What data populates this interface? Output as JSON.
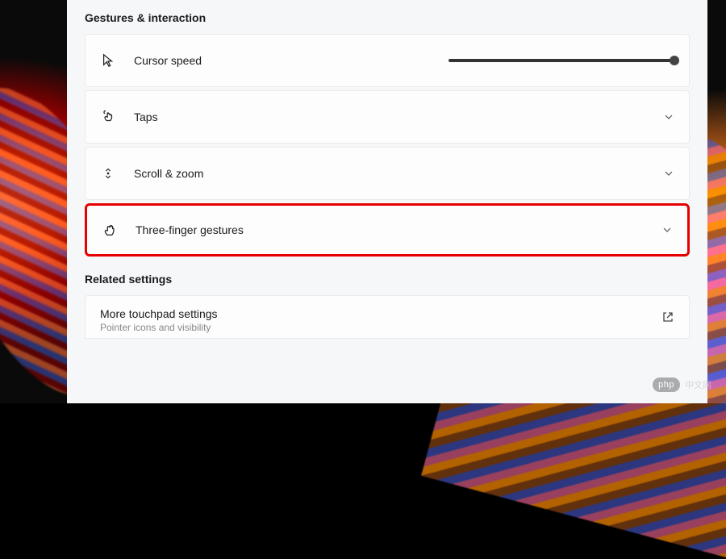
{
  "sections": {
    "gestures": {
      "header": "Gestures & interaction",
      "items": {
        "cursor_speed": {
          "label": "Cursor speed"
        },
        "taps": {
          "label": "Taps"
        },
        "scroll_zoom": {
          "label": "Scroll & zoom"
        },
        "three_finger": {
          "label": "Three-finger gestures"
        }
      }
    },
    "related": {
      "header": "Related settings",
      "more_touchpad": {
        "title": "More touchpad settings",
        "subtitle": "Pointer icons and visibility"
      }
    }
  },
  "watermark": {
    "badge": "php",
    "text": "中文网"
  }
}
